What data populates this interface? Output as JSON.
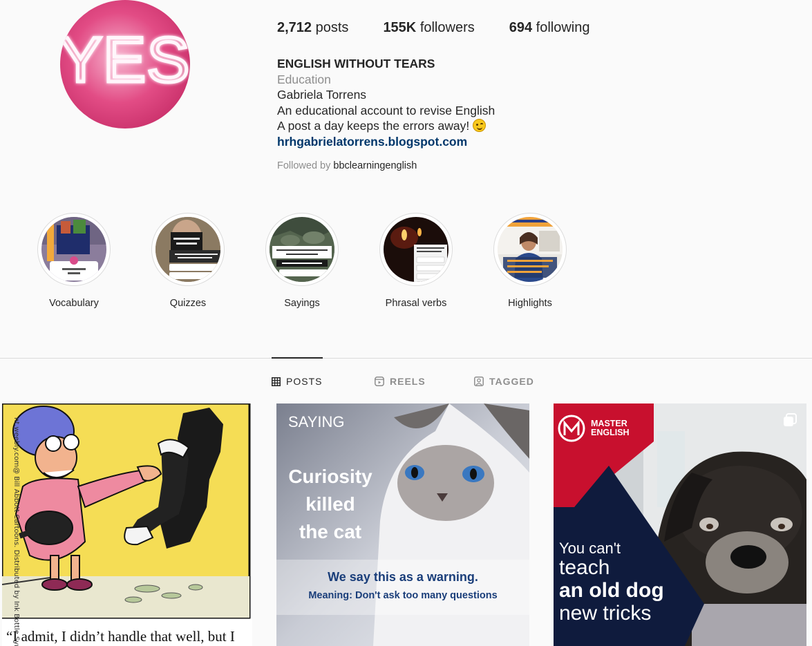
{
  "profile": {
    "avatar_text": "YES",
    "stats": {
      "posts_count": "2,712",
      "posts_label": "posts",
      "followers_count": "155K",
      "followers_label": "followers",
      "following_count": "694",
      "following_label": "following"
    },
    "name": "ENGLISH WITHOUT TEARS",
    "category": "Education",
    "bio_lines": [
      "Gabriela Torrens",
      "An educational account to revise English",
      "A post a day keeps the errors away!"
    ],
    "link": "hrhgabrielatorrens.blogspot.com",
    "followed_by_label": "Followed by",
    "followed_by_user": "bbclearningenglish"
  },
  "highlights": [
    {
      "label": "Vocabulary",
      "icon": "vocabulary-highlight"
    },
    {
      "label": "Quizzes",
      "icon": "quizzes-highlight"
    },
    {
      "label": "Sayings",
      "icon": "sayings-highlight"
    },
    {
      "label": "Phrasal verbs",
      "icon": "phrasal-verbs-highlight"
    },
    {
      "label": "Highlights",
      "icon": "highlights-highlight"
    }
  ],
  "tabs": [
    {
      "label": "POSTS",
      "icon": "grid-icon",
      "active": true
    },
    {
      "label": "REELS",
      "icon": "reels-icon",
      "active": false
    },
    {
      "label": "TAGGED",
      "icon": "tagged-icon",
      "active": false
    }
  ],
  "posts": [
    {
      "caption": "“I admit, I didn’t handle that well, but I"
    },
    {
      "kicker": "SAYING",
      "title_lines": [
        "Curiosity",
        "killed",
        "the cat"
      ],
      "line1": "We say this as a warning.",
      "line2": "Meaning: Don't ask too many questions"
    },
    {
      "brand_line1": "MASTER",
      "brand_line2": "ENGLISH",
      "text_lines": [
        "You can't",
        "teach",
        "an old dog",
        "new tricks"
      ],
      "multi_icon": "carousel-icon"
    }
  ],
  "colors": {
    "link": "#00376b",
    "muted": "#8e8e8e",
    "text": "#262626",
    "brand_red": "#c8102e",
    "brand_navy": "#0f1b3d"
  }
}
